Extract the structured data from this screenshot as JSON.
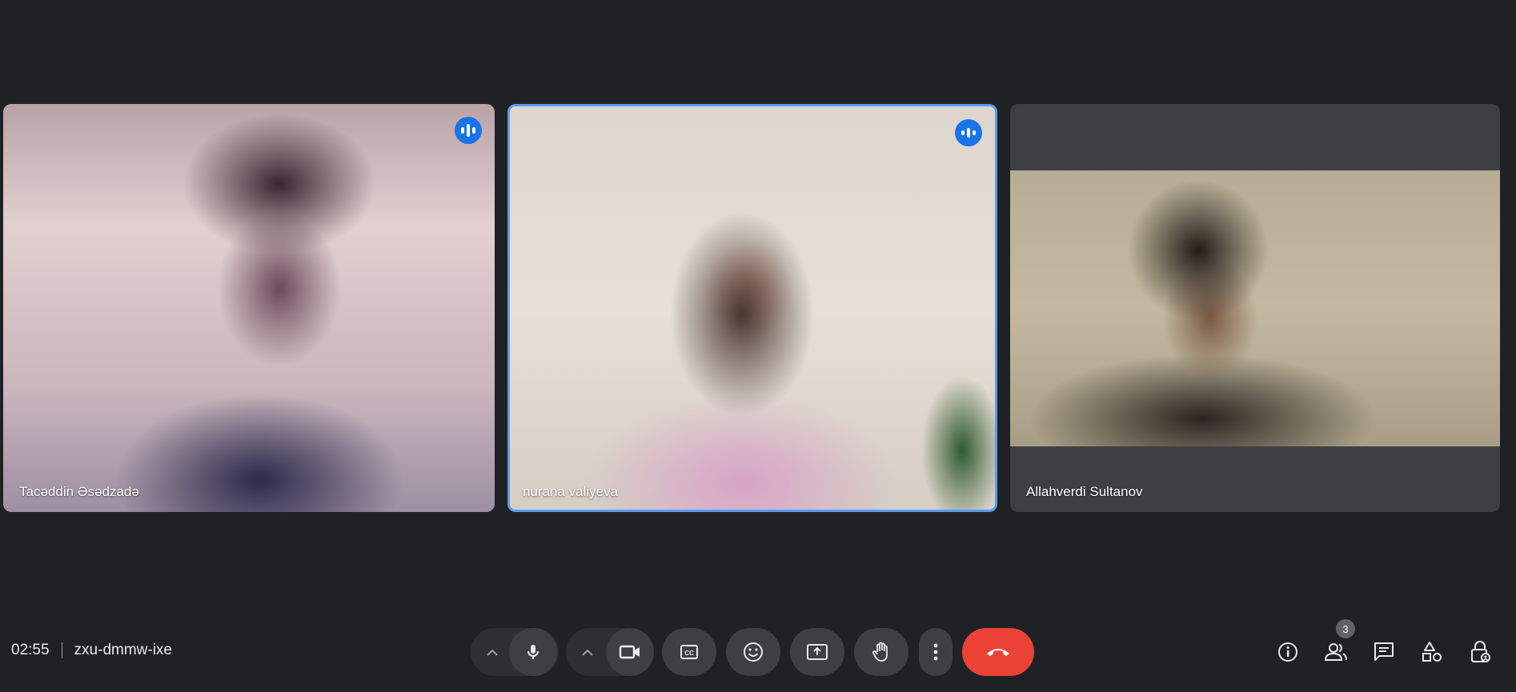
{
  "participants": [
    {
      "name": "Tacəddin Əsədzadə",
      "speaking": true
    },
    {
      "name": "nurana valiyeva",
      "speaking": true,
      "active": true
    },
    {
      "name": "Allahverdi Sultanov",
      "speaking": false
    }
  ],
  "meeting": {
    "time": "02:55",
    "code": "zxu-dmmw-ixe"
  },
  "people_count": "3",
  "controls": {
    "mic": "microphone-icon",
    "camera": "camera-icon",
    "captions": "captions-icon",
    "emoji": "emoji-icon",
    "present": "present-screen-icon",
    "hand": "raise-hand-icon",
    "more": "more-options-icon",
    "leave": "end-call-icon"
  },
  "right_controls": [
    "info-icon",
    "people-icon",
    "chat-icon",
    "activities-icon",
    "host-controls-icon"
  ],
  "colors": {
    "background": "#202124",
    "end_call": "#ea4335",
    "accent": "#1a73e8",
    "active_border": "#5a9cf5"
  }
}
